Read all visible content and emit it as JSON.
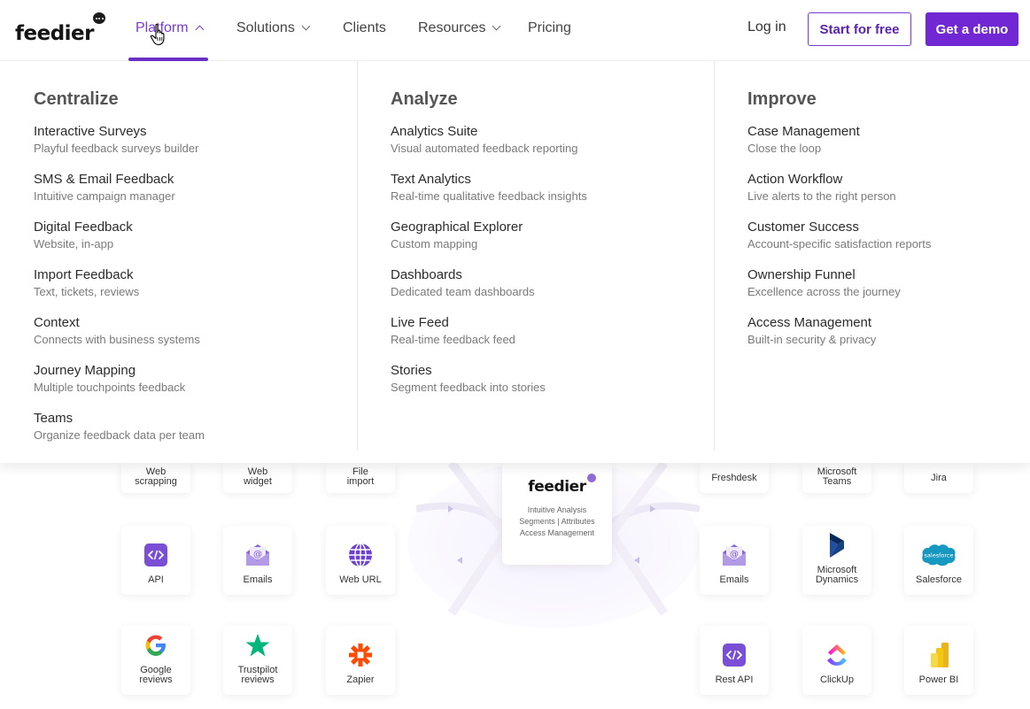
{
  "nav": {
    "logo": "feedier",
    "items": [
      {
        "label": "Platform",
        "has_dropdown": true,
        "active": true
      },
      {
        "label": "Solutions",
        "has_dropdown": true,
        "active": false
      },
      {
        "label": "Clients",
        "has_dropdown": false,
        "active": false
      },
      {
        "label": "Resources",
        "has_dropdown": true,
        "active": false
      },
      {
        "label": "Pricing",
        "has_dropdown": false,
        "active": false
      }
    ],
    "login": "Log in",
    "start_free": "Start for free",
    "get_demo": "Get a demo"
  },
  "colors": {
    "accent": "#7128d4",
    "accent_text": "#7a3bd2"
  },
  "mega_menu": {
    "columns": [
      {
        "title": "Centralize",
        "entries": [
          {
            "title": "Interactive Surveys",
            "subtitle": "Playful feedback surveys builder"
          },
          {
            "title": "SMS & Email Feedback",
            "subtitle": "Intuitive campaign manager"
          },
          {
            "title": "Digital Feedback",
            "subtitle": "Website, in-app"
          },
          {
            "title": "Import Feedback",
            "subtitle": "Text, tickets, reviews"
          },
          {
            "title": "Context",
            "subtitle": "Connects with business systems"
          },
          {
            "title": "Journey Mapping",
            "subtitle": "Multiple touchpoints feedback"
          },
          {
            "title": "Teams",
            "subtitle": "Organize feedback data per team"
          }
        ]
      },
      {
        "title": "Analyze",
        "entries": [
          {
            "title": "Analytics Suite",
            "subtitle": "Visual automated feedback reporting"
          },
          {
            "title": "Text Analytics",
            "subtitle": "Real-time qualitative feedback insights"
          },
          {
            "title": "Geographical Explorer",
            "subtitle": "Custom mapping"
          },
          {
            "title": "Dashboards",
            "subtitle": "Dedicated team dashboards"
          },
          {
            "title": "Live Feed",
            "subtitle": "Real-time feedback feed"
          },
          {
            "title": "Stories",
            "subtitle": "Segment feedback into stories"
          }
        ]
      },
      {
        "title": "Improve",
        "entries": [
          {
            "title": "Case Management",
            "subtitle": "Close the loop"
          },
          {
            "title": "Action Workflow",
            "subtitle": "Live alerts to the right person"
          },
          {
            "title": "Customer Success",
            "subtitle": "Account-specific satisfaction reports"
          },
          {
            "title": "Ownership Funnel",
            "subtitle": "Excellence across the journey"
          },
          {
            "title": "Access Management",
            "subtitle": "Built-in security & privacy"
          }
        ]
      }
    ]
  },
  "integrations": {
    "left_partial": [
      "Web\nscrapping",
      "Web\nwidget",
      "File\nimport"
    ],
    "left_row2": [
      {
        "label": "API",
        "icon": "code-icon"
      },
      {
        "label": "Emails",
        "icon": "email-icon"
      },
      {
        "label": "Web URL",
        "icon": "globe-icon"
      }
    ],
    "left_row3": [
      {
        "label": "Google\nreviews",
        "icon": "google-icon"
      },
      {
        "label": "Trustpilot\nreviews",
        "icon": "trustpilot-star-icon"
      },
      {
        "label": "Zapier",
        "icon": "zapier-icon"
      }
    ],
    "center": {
      "logo": "feedier",
      "line1": "Intuitive Analysis",
      "line2": "Segments | Attributes",
      "line3": "Access Management"
    },
    "right_partial": [
      "Freshdesk",
      "Microsoft\nTeams",
      "Jira"
    ],
    "right_row2": [
      {
        "label": "Emails",
        "icon": "email-icon"
      },
      {
        "label": "Microsoft\nDynamics",
        "icon": "dynamics-icon"
      },
      {
        "label": "Salesforce",
        "icon": "salesforce-icon"
      }
    ],
    "right_row3": [
      {
        "label": "Rest API",
        "icon": "code-icon"
      },
      {
        "label": "ClickUp",
        "icon": "clickup-icon"
      },
      {
        "label": "Power BI",
        "icon": "powerbi-icon"
      }
    ],
    "salesforce_logo_text": "salesforce"
  }
}
